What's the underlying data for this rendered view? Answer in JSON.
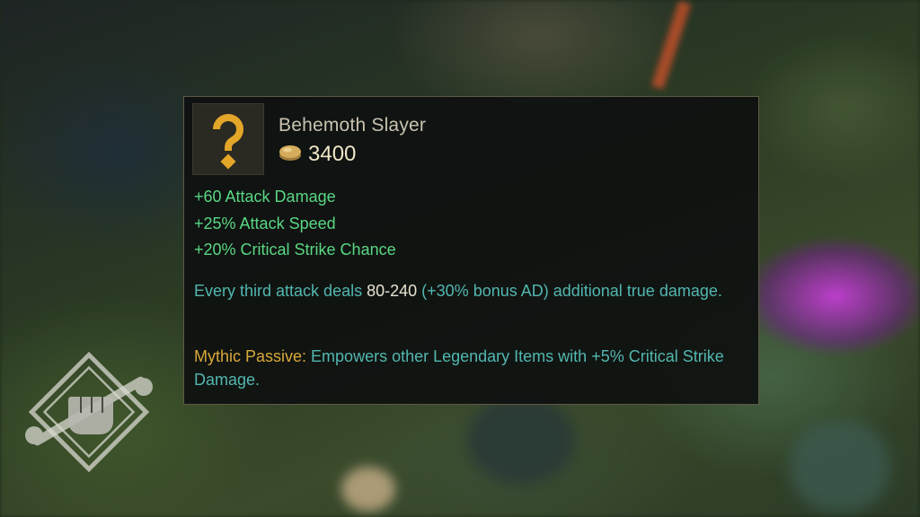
{
  "item": {
    "name": "Behemoth Slayer",
    "price": "3400",
    "icon": "question-mark-icon",
    "price_icon": "gold-coin-icon",
    "stats": [
      "+60 Attack Damage",
      "+25% Attack Speed",
      "+20% Critical Strike Chance"
    ],
    "passive": {
      "text_before": "Every third attack deals ",
      "highlight": "80-240",
      "text_after": " (+30% bonus AD) additional true damage."
    },
    "mythic": {
      "label": "Mythic Passive:",
      "text": " Empowers other Legendary Items with +5% Critical Strike Damage."
    }
  },
  "watermark": {
    "icon": "fist-wrench-logo"
  },
  "colors": {
    "stat_green": "#5ad784",
    "passive_teal": "#52b7b0",
    "mythic_gold": "#d8a83a",
    "icon_gold": "#e3a628",
    "border": "#5e5a45"
  }
}
